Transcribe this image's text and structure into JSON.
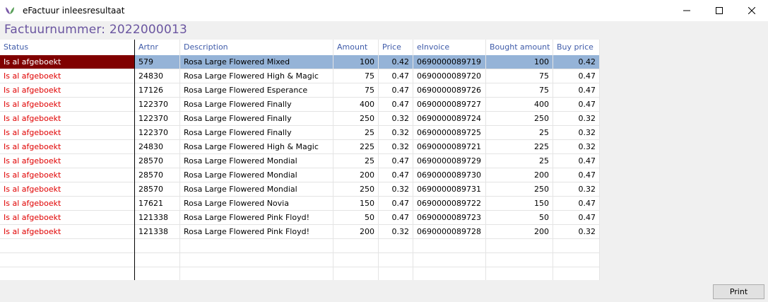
{
  "window": {
    "title": "eFactuur inleesresultaat"
  },
  "header": {
    "invoice_label": "Factuurnummer: 2022000013"
  },
  "columns": [
    "Status",
    "Artnr",
    "Description",
    "Amount",
    "Price",
    "eInvoice",
    "Bought amount",
    "Buy price"
  ],
  "rows": [
    {
      "status": "Is al afgeboekt",
      "artnr": "579",
      "description": "Rosa Large Flowered Mixed",
      "amount": "100",
      "price": "0.42",
      "einvoice": "0690000089719",
      "bought_amount": "100",
      "buy_price": "0.42",
      "selected": true
    },
    {
      "status": "Is al afgeboekt",
      "artnr": "24830",
      "description": "Rosa Large Flowered High & Magic",
      "amount": "75",
      "price": "0.47",
      "einvoice": "0690000089720",
      "bought_amount": "75",
      "buy_price": "0.47"
    },
    {
      "status": "Is al afgeboekt",
      "artnr": "17126",
      "description": "Rosa Large Flowered Esperance",
      "amount": "75",
      "price": "0.47",
      "einvoice": "0690000089726",
      "bought_amount": "75",
      "buy_price": "0.47"
    },
    {
      "status": "Is al afgeboekt",
      "artnr": "122370",
      "description": "Rosa Large Flowered Finally",
      "amount": "400",
      "price": "0.47",
      "einvoice": "0690000089727",
      "bought_amount": "400",
      "buy_price": "0.47"
    },
    {
      "status": "Is al afgeboekt",
      "artnr": "122370",
      "description": "Rosa Large Flowered Finally",
      "amount": "250",
      "price": "0.32",
      "einvoice": "0690000089724",
      "bought_amount": "250",
      "buy_price": "0.32"
    },
    {
      "status": "Is al afgeboekt",
      "artnr": "122370",
      "description": "Rosa Large Flowered Finally",
      "amount": "25",
      "price": "0.32",
      "einvoice": "0690000089725",
      "bought_amount": "25",
      "buy_price": "0.32"
    },
    {
      "status": "Is al afgeboekt",
      "artnr": "24830",
      "description": "Rosa Large Flowered High & Magic",
      "amount": "225",
      "price": "0.32",
      "einvoice": "0690000089721",
      "bought_amount": "225",
      "buy_price": "0.32"
    },
    {
      "status": "Is al afgeboekt",
      "artnr": "28570",
      "description": "Rosa Large Flowered Mondial",
      "amount": "25",
      "price": "0.47",
      "einvoice": "0690000089729",
      "bought_amount": "25",
      "buy_price": "0.47"
    },
    {
      "status": "Is al afgeboekt",
      "artnr": "28570",
      "description": "Rosa Large Flowered Mondial",
      "amount": "200",
      "price": "0.47",
      "einvoice": "0690000089730",
      "bought_amount": "200",
      "buy_price": "0.47"
    },
    {
      "status": "Is al afgeboekt",
      "artnr": "28570",
      "description": "Rosa Large Flowered Mondial",
      "amount": "250",
      "price": "0.32",
      "einvoice": "0690000089731",
      "bought_amount": "250",
      "buy_price": "0.32"
    },
    {
      "status": "Is al afgeboekt",
      "artnr": "17621",
      "description": "Rosa Large Flowered Novia",
      "amount": "150",
      "price": "0.47",
      "einvoice": "0690000089722",
      "bought_amount": "150",
      "buy_price": "0.47"
    },
    {
      "status": "Is al afgeboekt",
      "artnr": "121338",
      "description": "Rosa Large Flowered Pink Floyd!",
      "amount": "50",
      "price": "0.47",
      "einvoice": "0690000089723",
      "bought_amount": "50",
      "buy_price": "0.47"
    },
    {
      "status": "Is al afgeboekt",
      "artnr": "121338",
      "description": "Rosa Large Flowered Pink Floyd!",
      "amount": "200",
      "price": "0.32",
      "einvoice": "0690000089728",
      "bought_amount": "200",
      "buy_price": "0.32"
    }
  ],
  "empty_rows": 3,
  "footer": {
    "print_label": "Print"
  },
  "colors": {
    "header_text": "#6a55a0",
    "column_header": "#3f5ba9",
    "status_text": "#e00000",
    "selected_status_bg": "#800000",
    "selected_row_bg": "#95b3d7"
  }
}
